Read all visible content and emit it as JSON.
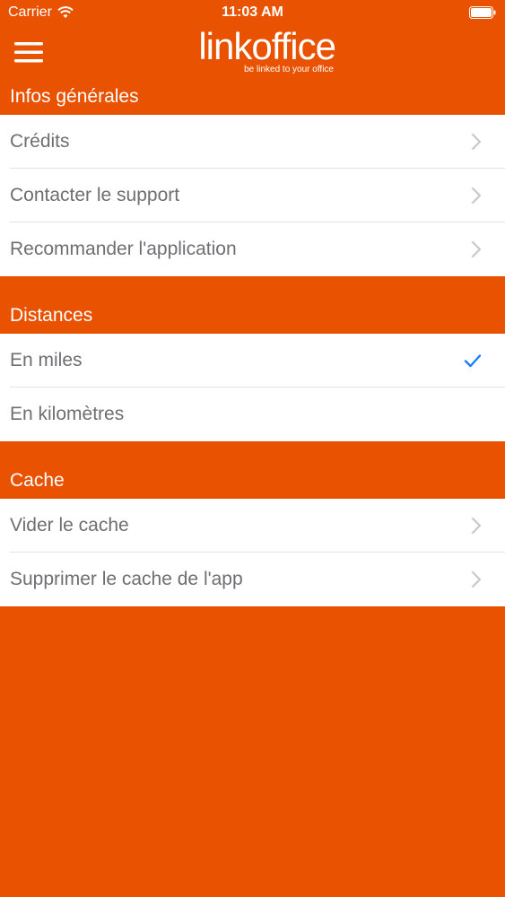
{
  "status_bar": {
    "carrier": "Carrier",
    "time": "11:03 AM"
  },
  "nav": {
    "menu_icon": "hamburger-menu-icon",
    "logo_text": "linkoffice",
    "logo_tagline": "be linked to your office"
  },
  "sections": [
    {
      "title": "Infos générales",
      "items": [
        {
          "label": "Crédits",
          "accessory": "chevron"
        },
        {
          "label": "Contacter le support",
          "accessory": "chevron"
        },
        {
          "label": "Recommander l'application",
          "accessory": "chevron"
        }
      ]
    },
    {
      "title": "Distances",
      "items": [
        {
          "label": "En miles",
          "accessory": "checkmark",
          "selected": true
        },
        {
          "label": "En kilomètres",
          "accessory": "none",
          "selected": false
        }
      ]
    },
    {
      "title": "Cache",
      "items": [
        {
          "label": "Vider le cache",
          "accessory": "chevron"
        },
        {
          "label": "Supprimer le cache de l'app",
          "accessory": "chevron"
        }
      ]
    }
  ],
  "colors": {
    "brand_orange": "#E85200",
    "row_text": "#6e6e73",
    "checkmark": "#1a7ef5",
    "chevron": "#c7c7cc"
  }
}
